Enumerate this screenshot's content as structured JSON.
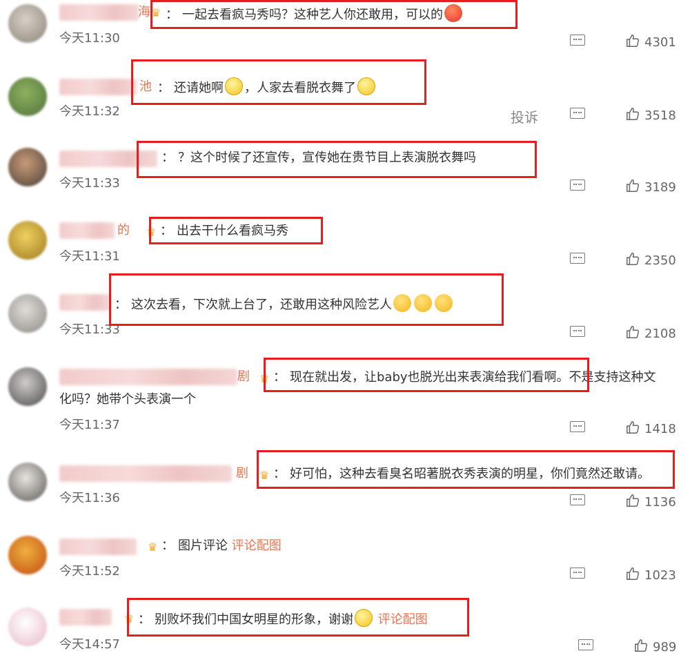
{
  "comments": [
    {
      "name_tail": "海",
      "text": "一起去看疯马秀吗？这种艺人你还敢用，可以的",
      "time": "今天11:30",
      "likes": "4301"
    },
    {
      "name_tail": "池",
      "text_a": "还请她啊",
      "text_b": "，人家去看脱衣舞了",
      "time": "今天11:32",
      "report": "投诉",
      "likes": "3518"
    },
    {
      "name_tail": "",
      "text": "？这个时候了还宣传，宣传她在贵节目上表演脱衣舞吗",
      "time": "今天11:33",
      "likes": "3189"
    },
    {
      "name_tail": "的",
      "text": "出去干什么看疯马秀",
      "time": "今天11:31",
      "likes": "2350"
    },
    {
      "name_tail": "",
      "text": "这次去看，下次就上台了，还敢用这种风险艺人",
      "time": "今天11:33",
      "likes": "2108"
    },
    {
      "name_tail": "剧",
      "text": "现在就出发，让baby也脱光出来表演给我们看啊。不是支持这种文",
      "text_cont": "化吗？她带个头表演一个",
      "time": "今天11:37",
      "likes": "1418"
    },
    {
      "name_tail": "剧",
      "text": "好可怕，这种去看臭名昭著脱衣秀表演的明星，你们竟然还敢请。",
      "time": "今天11:36",
      "likes": "1136"
    },
    {
      "name_tail": "",
      "text": "图片评论",
      "link": "评论配图",
      "time": "今天11:52",
      "likes": "1023"
    },
    {
      "name_tail": "",
      "text": "别败坏我们中国女明星的形象，谢谢",
      "link": "评论配图",
      "time": "今天14:57",
      "likes": "989"
    }
  ],
  "colon": "：",
  "vip_icon": "crown-badge-icon",
  "colors": {
    "highlight_box": "#e81c1c",
    "username": "#eb7350",
    "link": "#eb7350"
  }
}
